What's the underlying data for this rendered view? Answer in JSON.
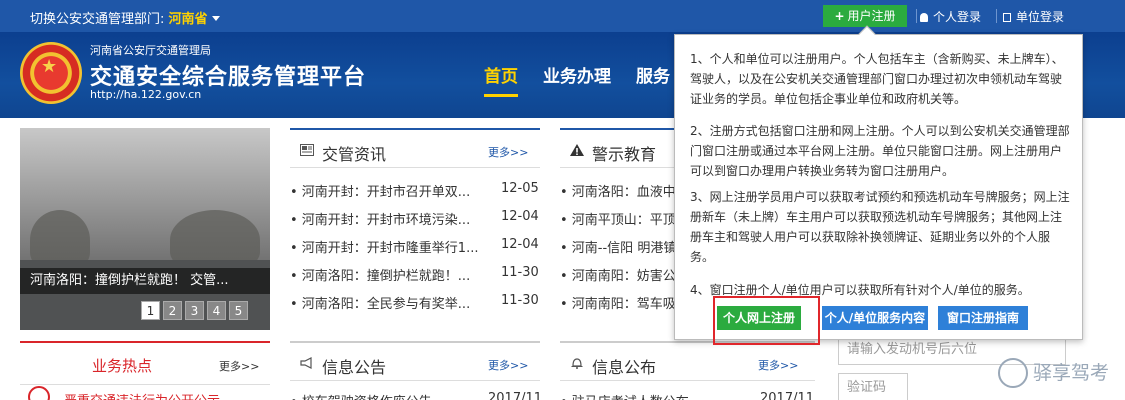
{
  "topbar": {
    "region_label": "切换公安交通管理部门:",
    "region_value": "河南省",
    "register_label": "用户注册",
    "personal_login": "个人登录",
    "unit_login": "单位登录"
  },
  "header": {
    "subtitle": "河南省公安厅交通管理局",
    "title": "交通安全综合服务管理平台",
    "url": "http://ha.122.gov.cn",
    "nav": [
      "首页",
      "业务办理",
      "服务"
    ]
  },
  "slider": {
    "caption": "河南洛阳：撞倒护栏就跑！ 交管...",
    "pages": [
      "1",
      "2",
      "3",
      "4",
      "5"
    ],
    "active_page": "1"
  },
  "news_panel": {
    "title": "交管资讯",
    "more": "更多>>",
    "items": [
      {
        "text": "• 河南开封：开封市召开单双...",
        "date": "12-05"
      },
      {
        "text": "• 河南开封：开封市环境污染...",
        "date": "12-04"
      },
      {
        "text": "• 河南开封：开封市隆重举行1...",
        "date": "12-04"
      },
      {
        "text": "• 河南洛阳：撞倒护栏就跑！...",
        "date": "11-30"
      },
      {
        "text": "• 河南洛阳：全民参与有奖举...",
        "date": "11-30"
      }
    ]
  },
  "warning_panel": {
    "title": "警示教育",
    "items": [
      "• 河南洛阳：血液中",
      "• 河南平顶山：平顶",
      "• 河南--信阳 明港镇",
      "• 河南南阳：妨害公",
      "• 河南南阳：驾车吸"
    ]
  },
  "hot_panel": {
    "title": "业务热点",
    "more": "更多>>",
    "first_item": "严重交通违法行为公开公示"
  },
  "notice_panel": {
    "title": "信息公告",
    "more": "更多>>",
    "first_item": "• 校车驾驶资格作废公告",
    "first_date": "2017/11"
  },
  "publish_panel": {
    "title": "信息公布",
    "more": "更多>>",
    "first_item": "• 驻马店考试人数公布",
    "first_date": "2017/11"
  },
  "right_form": {
    "engine_placeholder": "请输入发动机号后六位",
    "captcha_placeholder": "验证码"
  },
  "popup": {
    "paragraphs": [
      "1、个人和单位可以注册用户。个人包括车主（含新购买、未上牌车）、驾驶人，以及在公安机关交通管理部门窗口办理过初次申领机动车驾驶证业务的学员。单位包括企事业单位和政府机关等。",
      "2、注册方式包括窗口注册和网上注册。个人可以到公安机关交通管理部门窗口注册或通过本平台网上注册。单位只能窗口注册。网上注册用户可以到窗口办理用户转换业务转为窗口注册用户。",
      "3、网上注册学员用户可以获取考试预约和预选机动车号牌服务；网上注册新车（未上牌）车主用户可以获取预选机动车号牌服务；其他网上注册车主和驾驶人用户可以获取除补换领牌证、延期业务以外的个人服务。",
      "4、窗口注册个人/单位用户可以获取所有针对个人/单位的服务。"
    ],
    "btn_online": "个人网上注册",
    "btn_service": "个人/单位服务内容",
    "btn_guide": "窗口注册指南"
  },
  "watermark": "驿享驾考",
  "colors": {
    "topbar": "#1f57a8",
    "accent_yellow": "#ffd200",
    "green": "#2bab3f",
    "blue": "#2e80d8",
    "red": "#d9252a"
  }
}
